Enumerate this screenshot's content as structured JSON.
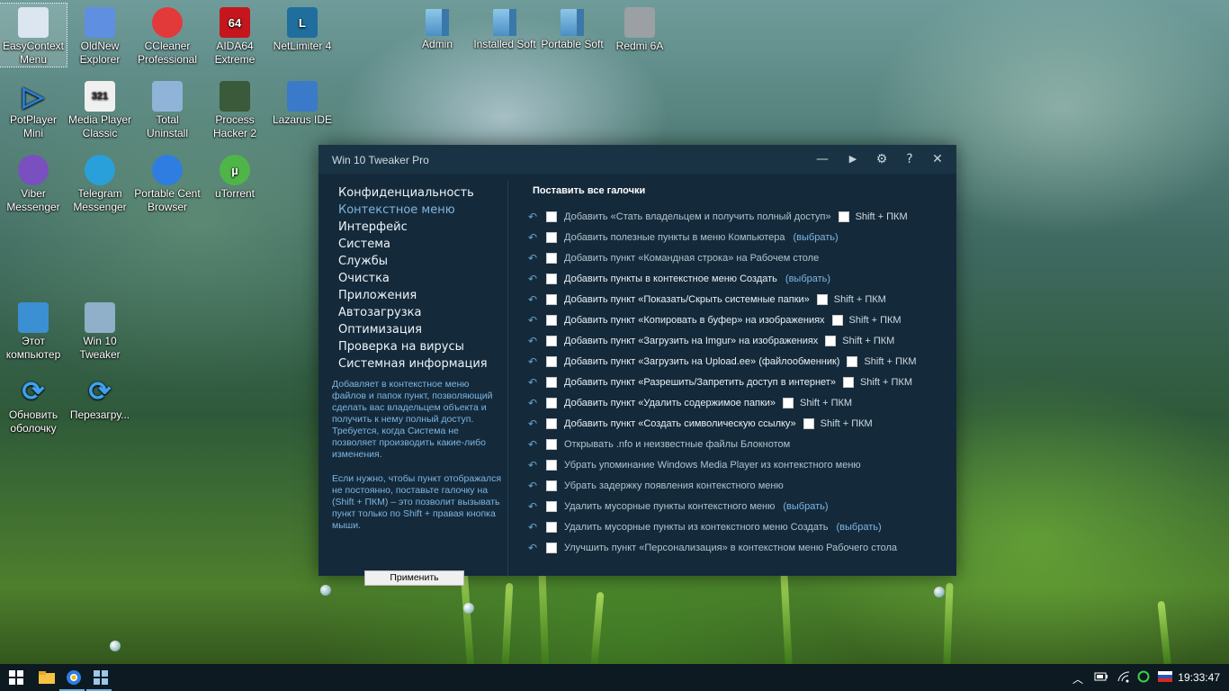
{
  "desktop_icons": [
    {
      "label": "EasyContext Menu",
      "icon": "context-menu-icon"
    },
    {
      "label": "OldNew Explorer",
      "icon": "shield-icon"
    },
    {
      "label": "CCleaner Professional",
      "icon": "ccleaner-icon"
    },
    {
      "label": "AIDA64 Extreme",
      "icon": "aida64-icon",
      "glyph": "64"
    },
    {
      "label": "NetLimiter 4",
      "icon": "netlimiter-icon",
      "glyph": "L"
    },
    {
      "label": "Admin",
      "icon": "folder-icon"
    },
    {
      "label": "Installed Soft",
      "icon": "folder-icon"
    },
    {
      "label": "Portable Soft",
      "icon": "folder-icon"
    },
    {
      "label": "Redmi 6A",
      "icon": "drive-icon"
    },
    {
      "label": "PotPlayer Mini",
      "icon": "play-icon",
      "glyph": "▷"
    },
    {
      "label": "Media Player Classic",
      "icon": "media-player-icon",
      "glyph": "321"
    },
    {
      "label": "Total Uninstall",
      "icon": "uninstall-icon"
    },
    {
      "label": "Process Hacker 2",
      "icon": "process-hacker-icon"
    },
    {
      "label": "Lazarus IDE",
      "icon": "lazarus-icon"
    },
    {
      "label": "Viber Messenger",
      "icon": "viber-icon"
    },
    {
      "label": "Telegram Messenger",
      "icon": "telegram-icon"
    },
    {
      "label": "Portable Cent Browser",
      "icon": "browser-icon"
    },
    {
      "label": "uTorrent",
      "icon": "utorrent-icon",
      "glyph": "µ"
    },
    {
      "label": "Этот компьютер",
      "icon": "computer-icon"
    },
    {
      "label": "Win 10 Tweaker",
      "icon": "windows-icon"
    },
    {
      "label": "Обновить оболочку",
      "icon": "refresh-icon",
      "glyph": "⟳"
    },
    {
      "label": "Перезагру...",
      "icon": "restart-icon",
      "glyph": "⟳"
    }
  ],
  "window": {
    "title": "Win 10 Tweaker Pro",
    "buttons": {
      "minimize": "—",
      "play": "▶",
      "settings": "⚙",
      "help": "?",
      "close": "✕"
    },
    "nav": [
      {
        "label": "Конфиденциальность",
        "active": false
      },
      {
        "label": "Контекстное меню",
        "active": true
      },
      {
        "label": "Интерфейс",
        "active": false
      },
      {
        "label": "Система",
        "active": false
      },
      {
        "label": "Службы",
        "active": false
      },
      {
        "label": "Очистка",
        "active": false
      },
      {
        "label": "Приложения",
        "active": false
      },
      {
        "label": "Автозагрузка",
        "active": false
      },
      {
        "label": "Оптимизация",
        "active": false
      },
      {
        "label": "Проверка на вирусы",
        "active": false
      },
      {
        "label": "Системная информация",
        "active": false
      }
    ],
    "description_1": "Добавляет в контекстное меню файлов и папок пункт, позволяющий сделать вас владельцем объекта и получить к нему полный доступ. Требуется, когда Система не позволяет производить какие-либо изменения.",
    "description_2": "Если нужно, чтобы пункт отображался не постоянно, поставьте галочку на (Shift + ПКМ) – это позволит вызывать пункт только по Shift + правая кнопка мыши.",
    "apply_label": "Применить",
    "check_all_label": "Поставить все галочки",
    "options": [
      {
        "text": "Добавить «Стать владельцем и получить полный доступ»",
        "shift": "Shift + ПКМ",
        "dim": true
      },
      {
        "text": "Добавить полезные пункты в меню Компьютера",
        "link": "(выбрать)",
        "dim": true
      },
      {
        "text": "Добавить пункт «Командная строка» на Рабочем столе",
        "dim": true
      },
      {
        "text": "Добавить пункты в контекстное меню Создать",
        "link": "(выбрать)",
        "dim": false
      },
      {
        "text": "Добавить пункт «Показать/Скрыть системные папки»",
        "shift": "Shift + ПКМ",
        "dim": false
      },
      {
        "text": "Добавить пункт «Копировать в буфер» на изображениях",
        "shift": "Shift + ПКМ",
        "dim": false
      },
      {
        "text": "Добавить пункт «Загрузить на Imgur» на изображениях",
        "shift": "Shift + ПКМ",
        "dim": false
      },
      {
        "text": "Добавить пункт «Загрузить на Upload.ee» (файлообменник)",
        "shift": "Shift + ПКМ",
        "dim": false
      },
      {
        "text": "Добавить пункт «Разрешить/Запретить доступ в интернет»",
        "shift": "Shift + ПКМ",
        "dim": false
      },
      {
        "text": "Добавить пункт «Удалить содержимое папки»",
        "shift": "Shift + ПКМ",
        "dim": false
      },
      {
        "text": "Добавить пункт «Создать символическую ссылку»",
        "shift": "Shift + ПКМ",
        "dim": false
      },
      {
        "text": "Открывать .nfo и неизвестные файлы Блокнотом",
        "dim": true
      },
      {
        "text": "Убрать упоминание Windows Media Player из контекстного меню",
        "dim": true
      },
      {
        "text": "Убрать задержку появления контекстного меню",
        "dim": true
      },
      {
        "text": "Удалить мусорные пункты контекстного меню",
        "link": "(выбрать)",
        "dim": true
      },
      {
        "text": "Удалить мусорные пункты из контекстного меню Создать",
        "link": "(выбрать)",
        "dim": true
      },
      {
        "text": "Улучшить пункт «Персонализация» в контекстном меню Рабочего стола",
        "dim": true
      }
    ]
  },
  "taskbar": {
    "clock": "19:33:47",
    "pinned": [
      "start-icon",
      "explorer-icon",
      "browser-icon",
      "windows-icon"
    ],
    "tray": [
      "chevron-up-icon",
      "battery-icon",
      "wifi-icon",
      "circle-icon",
      "flag-ru-icon"
    ]
  }
}
